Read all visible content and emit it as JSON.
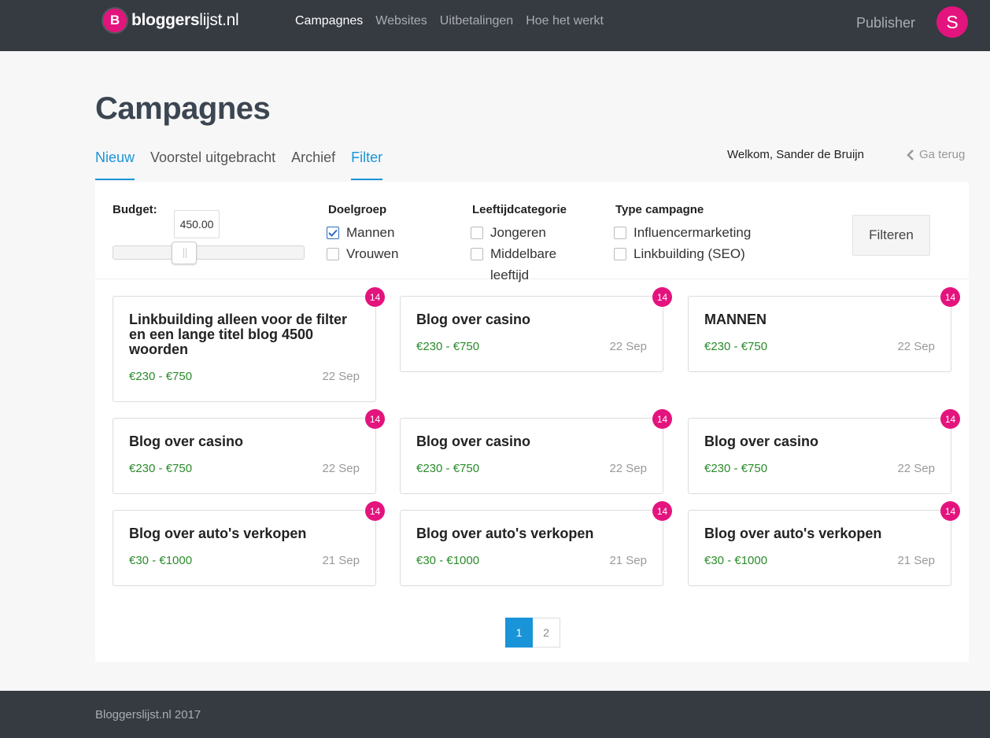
{
  "header": {
    "logo_letter": "B",
    "logo_bold": "bloggers",
    "logo_rest": "lijst.nl",
    "nav": [
      {
        "label": "Campagnes",
        "active": true
      },
      {
        "label": "Websites",
        "active": false
      },
      {
        "label": "Uitbetalingen",
        "active": false
      },
      {
        "label": "Hoe het werkt",
        "active": false
      }
    ],
    "role": "Publisher",
    "avatar_letter": "S"
  },
  "page": {
    "title": "Campagnes",
    "tabs": [
      {
        "label": "Nieuw",
        "active": true
      },
      {
        "label": "Voorstel uitgebracht",
        "active": false
      },
      {
        "label": "Archief",
        "active": false
      },
      {
        "label": "Filter",
        "active": true
      }
    ],
    "welcome": "Welkom, Sander de Bruijn",
    "back_label": "Ga terug"
  },
  "filters": {
    "budget_label": "Budget:",
    "budget_value": "450.00",
    "budget_fraction": 0.35,
    "doelgroep": {
      "label": "Doelgroep",
      "options": [
        {
          "label": "Mannen",
          "checked": true
        },
        {
          "label": "Vrouwen",
          "checked": false
        }
      ]
    },
    "leeftijd": {
      "label": "Leeftijdcategorie",
      "options": [
        {
          "label": "Jongeren",
          "checked": false
        },
        {
          "label": "Middelbare leeftijd",
          "checked": false
        }
      ]
    },
    "type": {
      "label": "Type campagne",
      "options": [
        {
          "label": "Influencermarketing",
          "checked": false
        },
        {
          "label": "Linkbuilding (SEO)",
          "checked": false
        }
      ]
    },
    "submit_label": "Filteren"
  },
  "campaigns": [
    {
      "title": "Linkbuilding alleen voor de filter en een lange titel blog 4500 woorden",
      "price": "€230 - €750",
      "date": "22 Sep",
      "badge": "14"
    },
    {
      "title": "Blog over casino",
      "price": "€230 - €750",
      "date": "22 Sep",
      "badge": "14"
    },
    {
      "title": "MANNEN",
      "price": "€230 - €750",
      "date": "22 Sep",
      "badge": "14"
    },
    {
      "title": "Blog over casino",
      "price": "€230 - €750",
      "date": "22 Sep",
      "badge": "14"
    },
    {
      "title": "Blog over casino",
      "price": "€230 - €750",
      "date": "22 Sep",
      "badge": "14"
    },
    {
      "title": "Blog over casino",
      "price": "€230 - €750",
      "date": "22 Sep",
      "badge": "14"
    },
    {
      "title": "Blog over auto's verkopen",
      "price": "€30 - €1000",
      "date": "21 Sep",
      "badge": "14"
    },
    {
      "title": "Blog over auto's verkopen",
      "price": "€30 - €1000",
      "date": "21 Sep",
      "badge": "14"
    },
    {
      "title": "Blog over auto's verkopen",
      "price": "€30 - €1000",
      "date": "21 Sep",
      "badge": "14"
    }
  ],
  "pagination": {
    "pages": [
      "1",
      "2"
    ],
    "current": "1"
  },
  "footer": {
    "text": "Bloggerslijst.nl 2017"
  },
  "colors": {
    "brand": "#e3147d",
    "accent": "#1a94d8",
    "price": "#2a8a2a",
    "topbar": "#363a41"
  }
}
